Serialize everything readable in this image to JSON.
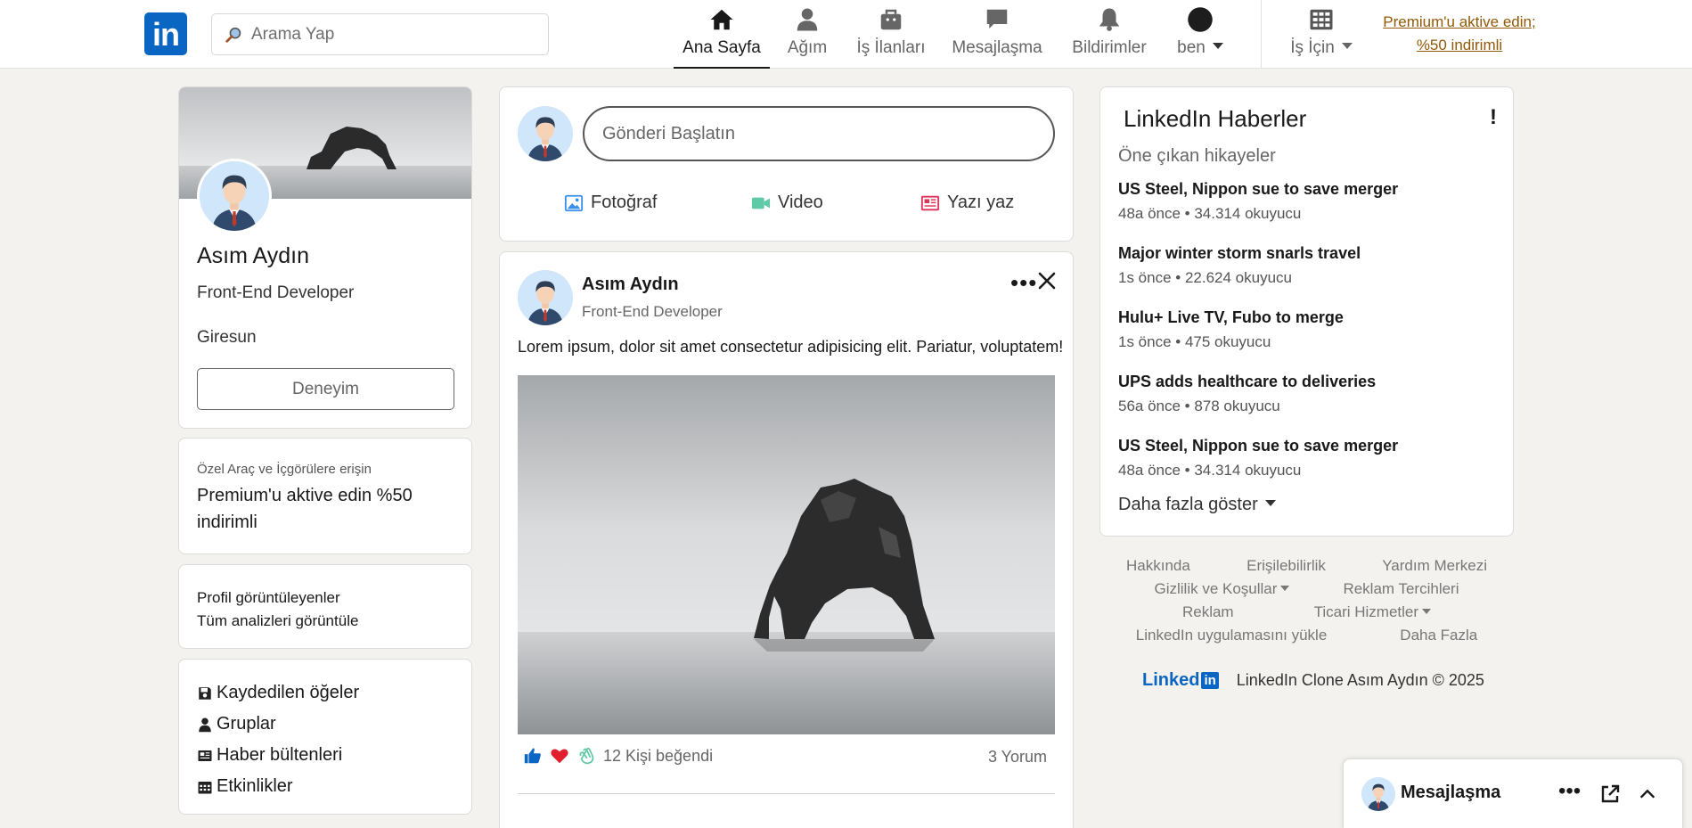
{
  "header": {
    "logo_text": "in",
    "search_placeholder": "Arama Yap",
    "nav": [
      {
        "label": "Ana Sayfa",
        "icon": "home-icon"
      },
      {
        "label": "Ağım",
        "icon": "network-icon"
      },
      {
        "label": "İş İlanları",
        "icon": "briefcase-icon"
      },
      {
        "label": "Mesajlaşma",
        "icon": "message-icon"
      },
      {
        "label": "Bildirimler",
        "icon": "bell-icon"
      },
      {
        "label": "ben",
        "icon": "profile-circle-icon"
      },
      {
        "label": "İş İçin",
        "icon": "grid-icon"
      }
    ],
    "premium_line1": "Premium'u aktive edin;",
    "premium_line2": "%50 indirimli"
  },
  "profile": {
    "name": "Asım Aydın",
    "title": "Front-End Developer",
    "city": "Giresun",
    "experience_button": "Deneyim"
  },
  "premium_card": {
    "caption": "Özel Araç ve İçgörülere erişin",
    "text": "Premium'u aktive edin %50 indirimli"
  },
  "analytics": {
    "line1": "Profil görüntüleyenler",
    "line2": "Tüm analizleri görüntüle"
  },
  "left_links": [
    {
      "label": "Kaydedilen öğeler",
      "icon": "save-icon"
    },
    {
      "label": "Gruplar",
      "icon": "user-icon"
    },
    {
      "label": "Haber bültenleri",
      "icon": "newspaper-icon"
    },
    {
      "label": "Etkinlikler",
      "icon": "calendar-icon"
    }
  ],
  "composer": {
    "placeholder": "Gönderi Başlatın",
    "actions": [
      {
        "label": "Fotoğraf",
        "icon": "photo-icon",
        "color": "#378fe9"
      },
      {
        "label": "Video",
        "icon": "video-icon",
        "color": "#5f9b41"
      },
      {
        "label": "Yazı yaz",
        "icon": "article-icon",
        "color": "#e06847"
      }
    ]
  },
  "post": {
    "author": "Asım Aydın",
    "author_title": "Front-End Developer",
    "text": "Lorem ipsum, dolor sit amet consectetur adipisicing elit. Pariatur, voluptatem!",
    "likes": "12 Kişi beğendi",
    "comments": "3 Yorum"
  },
  "news": {
    "title": "LinkedIn Haberler",
    "info": "!",
    "subtitle": "Öne çıkan hikayeler",
    "items": [
      {
        "headline": "US Steel, Nippon sue to save merger",
        "meta": "48a önce • 34.314 okuyucu"
      },
      {
        "headline": "Major winter storm snarls travel",
        "meta": "1s önce • 22.624 okuyucu"
      },
      {
        "headline": "Hulu+ Live TV, Fubo to merge",
        "meta": "1s önce • 475 okuyucu"
      },
      {
        "headline": "UPS adds healthcare to deliveries",
        "meta": "56a önce • 878 okuyucu"
      },
      {
        "headline": "US Steel, Nippon sue to save merger",
        "meta": "48a önce • 34.314 okuyucu"
      }
    ],
    "show_more": "Daha fazla göster"
  },
  "footer": {
    "links": [
      "Hakkında",
      "Erişilebilirlik",
      "Yardım Merkezi",
      "Gizlilik ve Koşullar",
      "Reklam Tercihleri",
      "Reklam",
      "Ticari Hizmetler",
      "LinkedIn uygulamasını yükle",
      "Daha Fazla"
    ],
    "brand": "Linked",
    "brand_in": "in",
    "copyright": "LinkedIn Clone Asım Aydın © 2025"
  },
  "messaging_dock": {
    "label": "Mesajlaşma"
  },
  "colors": {
    "brand": "#0a66c2",
    "premium": "#915907",
    "background": "#f4f2ee"
  }
}
